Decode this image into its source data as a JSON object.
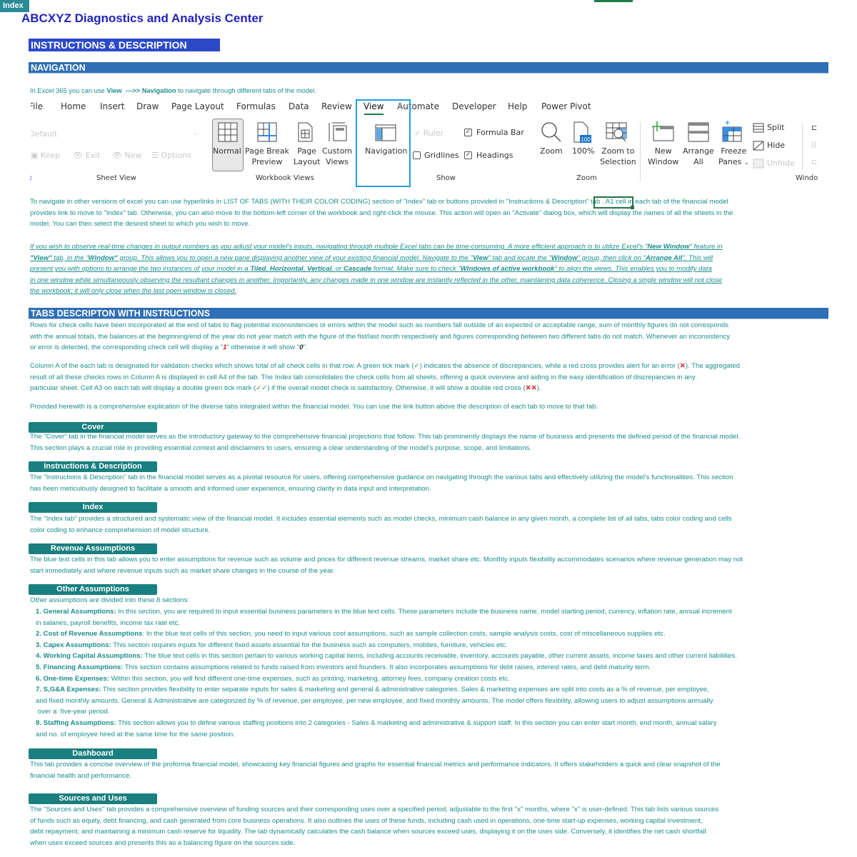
{
  "index_button": "Index",
  "title": "ABCXYZ Diagnostics and Analysis Center",
  "instructions_heading": "INSTRUCTIONS & DESCRIPTION",
  "navigation": {
    "heading": "NAVIGATION",
    "intro_prefix": "In Excel 365 you can use ",
    "intro_view": "View",
    "intro_arrow": "--->> ",
    "intro_nav": "Navigation",
    "intro_suffix": " to navigate through different tabs of the model.",
    "para1_lines": [
      "To navigate in other versions of excel you can use hyperlinks in LIST OF TABS (WITH THEIR COLOR CODING) section of \"Index\" tab or buttons provided in  \"Instructions & Description\" tab . A1 cell in each tab of the financial model",
      "provides link to move to \"Index\" tab. Otherwise, you can also move to the bottom-left corner of the workbook and right-click the mouse. This action will open an \"Activate\" dialog box, which will display the names of all the sheets in the",
      "model. You can then select the desired sheet to which you wish to move."
    ],
    "para2": {
      "l1a": "If you wish to observe real-time changes in output numbers as you adjust your model's inputs, navigating through multiple Excel tabs can be time-consuming. A more efficient approach is to utilize Excel's \"",
      "l1b": "New Window",
      "l1c": "\" feature in",
      "l2a": "\"View\"",
      "l2b": " tab, in the \"",
      "l2c": "Window\"",
      "l2d": " group. This allows you to open a new pane displaying another view of your existing financial model. Navigate to the \"",
      "l2e": "View",
      "l2f": "\" tab and locate the \"",
      "l2g": "Window",
      "l2h": "\" group, then click on \"",
      "l2i": "Arrange All",
      "l2j": "\".  This will",
      "l3a": "present you with options to arrange the two instances of your model in a ",
      "l3b": "Tiled",
      "l3c": ", ",
      "l3d": "Horizontal",
      "l3e": ", ",
      "l3f": "Vertical",
      "l3g": ", or ",
      "l3h": "Cascade",
      "l3i": " format. Make sure to check \"",
      "l3j": "Windows of active workbook",
      "l3k": "\" to align the views. This  enables you to modify data",
      "l4": "in one window while simultaneously observing the resultant changes in another. Importantly, any changes made in one window are instantly reflected in the other, maintaining data coherence. Closing a single window will not close",
      "l5": "the workbook; it will only close when the last open window is closed."
    }
  },
  "ribbon": {
    "tabs": [
      "File",
      "Home",
      "Insert",
      "Draw",
      "Page Layout",
      "Formulas",
      "Data",
      "Review",
      "View",
      "Automate",
      "Developer",
      "Help",
      "Power Pivot"
    ],
    "active_tab": "View",
    "sheet_view": {
      "dropdown_value": "Default",
      "keep": "Keep",
      "exit": "Exit",
      "new": "New",
      "options": "Options",
      "group_label": "Sheet View"
    },
    "workbook_views": {
      "normal": "Normal",
      "page_break_1": "Page Break",
      "page_break_2": "Preview",
      "page_layout_1": "Page",
      "page_layout_2": "Layout",
      "custom_1": "Custom",
      "custom_2": "Views",
      "group_label": "Workbook Views"
    },
    "navigation_label": "Navigation",
    "show": {
      "ruler": "Ruler",
      "formula_bar": "Formula Bar",
      "gridlines": "Gridlines",
      "headings": "Headings",
      "group_label": "Show",
      "ruler_checked": true,
      "formula_bar_checked": true,
      "gridlines_checked": false,
      "headings_checked": true
    },
    "zoom": {
      "zoom": "Zoom",
      "hundred": "100%",
      "hundred_icon_text": "100",
      "zoom_sel_1": "Zoom to",
      "zoom_sel_2": "Selection",
      "group_label": "Zoom"
    },
    "window": {
      "new_1": "New",
      "new_2": "Window",
      "arrange_1": "Arrange",
      "arrange_2": "All",
      "freeze_1": "Freeze",
      "freeze_2": "Panes",
      "split": "Split",
      "hide": "Hide",
      "unhide": "Unhide",
      "group_label": "Windo"
    }
  },
  "tabs_section": {
    "heading": "TABS DESCRIPTON WITH INSTRUCTIONS",
    "p1_lines": [
      "Rows for check cells have been incorporated at the end of tabs to flag potential inconsistencies or errors within the model such as numbers fall outside of an expected or acceptable range, sum of monthly figures do not corresponds",
      "with the annual totals, the balances at the beginning/end of the year do not year match with the figure of the fist/last month respectively and figures corresponding between two different tabs do not match. Whenever an inconsistency"
    ],
    "p1_l3a": "or error is detected, the corresponding check cell will display a \"",
    "p1_l3_one": "1",
    "p1_l3b": "\" otherwise it will show \"",
    "p1_l3_zero": "0",
    "p1_l3c": "\".",
    "p2_l1a": "Column A of the each tab is designated for validation checks which shows total of all check cells in that row. A green tick mark (",
    "tick": "✓",
    "p2_l1b": ") indicates the absence of discrepancies, while a red cross provides alert for an error (",
    "cross": "✕",
    "p2_l1c": "). The aggregated",
    "p2_l2": "result of all these checks rows in Column A is displayed in cell A4 of the tab. The Index tab consolidates the check cells from all sheets, offering a quick overview and aiding in the easy identification of discrepancies in any",
    "p2_l3a": "particular sheet. Cell A3 on each tab will display a double green tick mark (",
    "double_tick": "✓✓",
    "p2_l3b": ") if the overall model check is satisfactory. Otherwise, it will show a double red cross (",
    "double_cross": "✕✕",
    "p2_l3c": ").",
    "p3": "Provided herewith is a comprehensive explication of the diverse tabs integrated within the financial model. You can use the link button above the description of each tab to move to that tab."
  },
  "tab_entries": [
    {
      "button": "Cover",
      "lines": [
        "The \"Cover\" tab in the financial model serves as the introductory gateway to the comprehensive financial projections that follow. This tab prominently displays the name of business and presents the defined period of the financial model.",
        "This section plays  a crucial role in providing essential context and disclaimers to users, ensuring a clear understanding of the model's purpose, scope, and limitations."
      ]
    },
    {
      "button": "Instructions & Description",
      "lines": [
        "The \"Instructions & Description\" tab in the financial model serves as a pivotal resource for users, offering comprehensive guidance on navigating through the various tabs and effectively utilizing the model's functionalities. This section",
        "has been meticulously designed to facilitate a smooth and informed user experience, ensuring clarity in data input and interpretation."
      ]
    },
    {
      "button": "Index",
      "lines": [
        "The \"Index tab\" provides a structured and systematic view of the financial model. It includes essential elements such as model checks, minimum cash balance in any given month, a complete list of all tabs, tabs color coding and cells",
        "color coding to enhance comprehension of model structure."
      ]
    },
    {
      "button": "Revenue Assumptions",
      "lines": [
        "The blue text cells in this tab allows you to enter assumptions for revenue such as volume and prices for different revenue streams, market share etc. Monthly inputs flexibility accommodates scenarios where revenue generation may not",
        "start immediately and where revenue inputs such as market share changes in the course of the year."
      ]
    },
    {
      "button": "Other Assumptions",
      "lines": [
        "Other assumptions are divided into these 8 sections:"
      ]
    },
    {
      "button": "Dashboard",
      "lines": [
        "This tab provides a concise overview of the proforma financial model, showcasing key financial figures and graphs for essential financial metrics and performance indicators. It offers stakeholders a quick and clear snapshot of the",
        "financial health and performance."
      ]
    },
    {
      "button": "Sources and Uses",
      "lines": [
        "The \"Sources and Uses\" tab provides a comprehensive overview of funding sources and their corresponding uses over a specified period, adjustable to the first \"x\" months, where \"x\" is user-defined. This tab lists various sources",
        "of funds such as equity, debt financing, and cash generated from core business operations. It also outlines the uses of these funds, including cash used in operations, one-time start-up expenses, working capital investment,",
        "debt repayment, and maintaining  a minimum cash reserve for liquidity. The tab dynamically calculates the cash balance when sources exceed uses, displaying it on the uses side. Conversely, it identifies the net cash shortfall",
        "when uses exceed sources and presents this as a balancing figure on the sources side."
      ]
    }
  ],
  "other_assumptions_items": [
    {
      "title": "1. General Assumptions:",
      "lines": [
        " In this section, you are required to input essential business parameters in the blue text cells. These parameters include the business name, model starting period, currency, inflation rate, annual increment",
        "in salaries, payroll benefits, income tax rate etc."
      ]
    },
    {
      "title": "2. Cost of Revenue Assumptions",
      "lines": [
        ": In the blue text cells of this section, you need to input various cost assumptions, such as sample collection costs, sample analysis costs, cost of miscellaneous supplies etc."
      ]
    },
    {
      "title": "3. Capex Assumptions:",
      "lines": [
        " This section requires inputs for different fixed assets essential for the business such as computers, mobiles, furniture, vehicles etc."
      ]
    },
    {
      "title": "4. Working Capital Assumptions:",
      "lines": [
        " The blue text cells in this section pertain to various working capital items, including accounts receivable, inventory, accounts payable, other current assets, income taxes and other current liabilities."
      ]
    },
    {
      "title": "5. Financing Assumptions:",
      "lines": [
        " This section contains assumptions related to funds raised from investors and founders. It also incorporates assumptions for debt raises, interest rates, and debt maturity term."
      ]
    },
    {
      "title": "6. One-time Expenses:",
      "lines": [
        " Within this section, you will find different one-time expenses, such as printing, marketing, attorney fees, company creation costs etc."
      ]
    },
    {
      "title": "7. S,G&A Expenses:",
      "lines": [
        " This section provides flexibility to enter separate inputs for sales & marketing and general & administrative categories. Sales & marketing expenses are split into costs as a % of revenue, per employee,",
        "and fixed monthly amounts. General & Administrative are categorized by % of revenue, per employee, per new employee, and fixed monthly amounts. The model offers flexibility, allowing users to adjust assumptions annually",
        " over a  five-year period."
      ]
    },
    {
      "title": "8. Staffing Assumptions:",
      "lines": [
        " This section allows you to define various staffing positions into 2 categories - Sales & marketing and administrative & support staff. In this section you can enter start month, end month, annual salary",
        "and no. of employee hired at  the same time for the same position."
      ]
    }
  ]
}
